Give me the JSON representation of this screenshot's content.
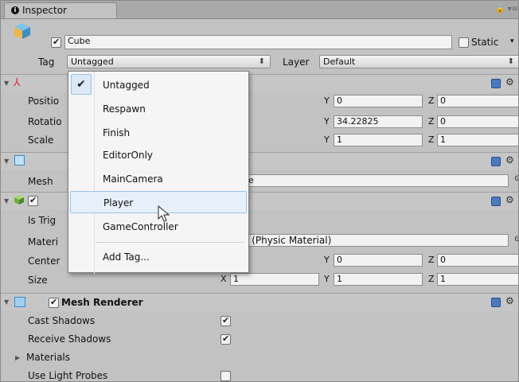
{
  "tab": {
    "title": "Inspector"
  },
  "object": {
    "name": "Cube",
    "static_label": "Static",
    "active": true
  },
  "tag": {
    "label": "Tag",
    "value": "Untagged"
  },
  "layer": {
    "label": "Layer",
    "value": "Default"
  },
  "transform": {
    "position_label": "Positio",
    "rotation_label": "Rotatio",
    "scale_label": "Scale",
    "position": {
      "y": "0",
      "z": "0"
    },
    "rotation": {
      "y": "34.22825",
      "z": "0"
    },
    "scale": {
      "y": "1",
      "z": "1"
    }
  },
  "mesh_filter": {
    "mesh_label": "Mesh",
    "mesh_value": "be"
  },
  "collider": {
    "is_trigger_label": "Is Trig",
    "material_label": "Materi",
    "material_value": "e (Physic Material)",
    "center_label": "Center",
    "size_label": "Size",
    "center": {
      "y": "0",
      "z": "0"
    },
    "size": {
      "x": "1",
      "y": "1",
      "z": "1"
    }
  },
  "mesh_renderer": {
    "title": "Mesh Renderer",
    "cast_shadows_label": "Cast Shadows",
    "cast_shadows": true,
    "receive_shadows_label": "Receive Shadows",
    "receive_shadows": true,
    "materials_label": "Materials",
    "use_light_probes_label": "Use Light Probes",
    "use_light_probes": false
  },
  "axis": {
    "x": "X",
    "y": "Y",
    "z": "Z"
  },
  "tag_menu": {
    "items": [
      "Untagged",
      "Respawn",
      "Finish",
      "EditorOnly",
      "MainCamera",
      "Player",
      "GameController"
    ],
    "selected": "Untagged",
    "hovered": "Player",
    "add_tag": "Add Tag..."
  }
}
